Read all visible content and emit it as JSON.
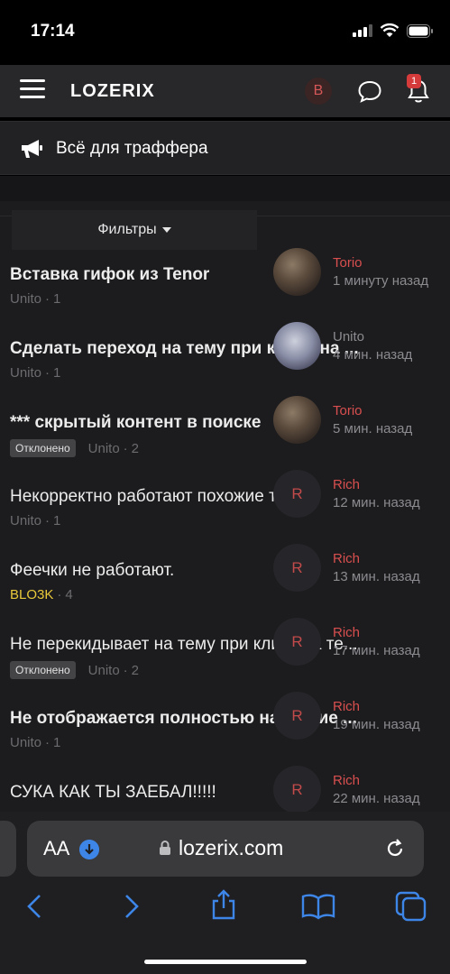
{
  "status": {
    "time": "17:14"
  },
  "header": {
    "logo": "LOZERIX",
    "avatar_letter": "B",
    "notification_count": "1"
  },
  "subheader": {
    "title": "Всё для траффера"
  },
  "filters": {
    "label": "Фильтры"
  },
  "threads": [
    {
      "title": "Вставка гифок из Tenor",
      "author": "Unito",
      "replies": "1",
      "tag": "",
      "last_user": "Torio",
      "time": "1 минуту назад",
      "avatar": "photo"
    },
    {
      "title": "Сделать переход на тему при клике на ...",
      "author": "Unito",
      "replies": "1",
      "tag": "",
      "last_user": "Unito",
      "time": "4 мин. назад",
      "avatar": "photo2"
    },
    {
      "title": "*** скрытый контент в поиске",
      "author": "Unito",
      "replies": "2",
      "tag": "Отклонено",
      "last_user": "Torio",
      "time": "5 мин. назад",
      "avatar": "photo"
    },
    {
      "title": "Некорректно работают похожие темы",
      "author": "Unito",
      "replies": "1",
      "tag": "",
      "last_user": "Rich",
      "time": "12 мин. назад",
      "avatar": "R"
    },
    {
      "title": "Феечки не работают.",
      "author": "BLO3K",
      "replies": "4",
      "tag": "",
      "last_user": "Rich",
      "time": "13 мин. назад",
      "avatar": "R"
    },
    {
      "title": "Не перекидывает на тему при клике на те...",
      "author": "Unito",
      "replies": "2",
      "tag": "Отклонено",
      "last_user": "Rich",
      "time": "17 мин. назад",
      "avatar": "R"
    },
    {
      "title": "Не отображается полностью название ...",
      "author": "Unito",
      "replies": "1",
      "tag": "",
      "last_user": "Rich",
      "time": "19 мин. назад",
      "avatar": "R"
    },
    {
      "title": "СУКА КАК ТЫ ЗАЕБАЛ!!!!!",
      "author": "",
      "replies": "",
      "tag": "",
      "last_user": "Rich",
      "time": "22 мин. назад",
      "avatar": "R"
    }
  ],
  "browser": {
    "aa_label": "AA",
    "url": "lozerix.com"
  }
}
